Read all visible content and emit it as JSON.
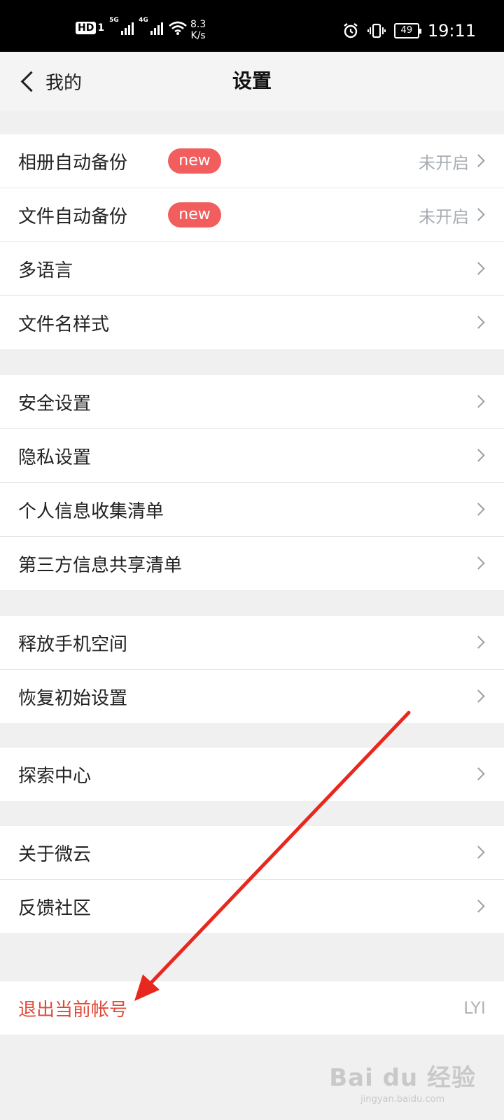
{
  "status_bar": {
    "hd": "HD",
    "hd_sim": "1",
    "sig1": "5G",
    "sig2": "4G",
    "speed_line1": "8.3",
    "speed_line2": "K/s",
    "battery": "49",
    "time": "19:11"
  },
  "nav": {
    "back_label": "我的",
    "title": "设置"
  },
  "groups": [
    [
      {
        "label": "相册自动备份",
        "badge": "new",
        "value": "未开启"
      },
      {
        "label": "文件自动备份",
        "badge": "new",
        "value": "未开启"
      },
      {
        "label": "多语言"
      },
      {
        "label": "文件名样式"
      }
    ],
    [
      {
        "label": "安全设置"
      },
      {
        "label": "隐私设置"
      },
      {
        "label": "个人信息收集清单"
      },
      {
        "label": "第三方信息共享清单"
      }
    ],
    [
      {
        "label": "释放手机空间"
      },
      {
        "label": "恢复初始设置"
      }
    ],
    [
      {
        "label": "探索中心"
      }
    ],
    [
      {
        "label": "关于微云"
      },
      {
        "label": "反馈社区"
      }
    ]
  ],
  "logout": {
    "label": "退出当前帐号",
    "user": "LYI"
  },
  "colors": {
    "accent_red": "#e04a3a",
    "badge_red": "#f25d5d",
    "annotation_arrow": "#e8281e"
  },
  "watermark": {
    "main": "Bai du 经验",
    "sub": "jingyan.baidu.com"
  }
}
